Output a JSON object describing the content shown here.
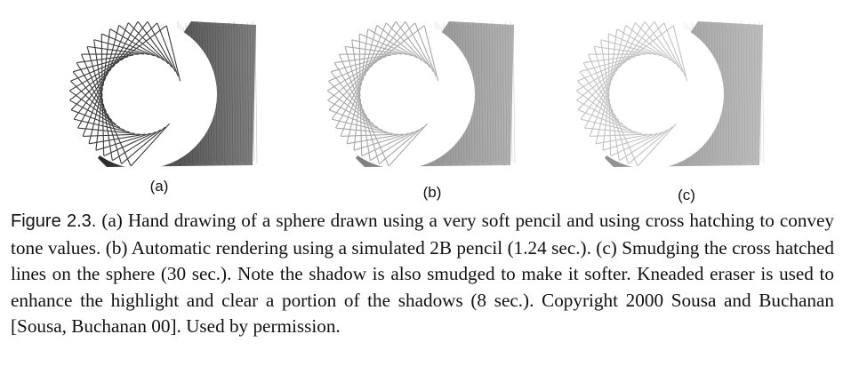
{
  "figure": {
    "sub_labels": [
      "(a)",
      "(b)",
      "(c)"
    ],
    "sketches": [
      {
        "hatch_color": "#3a3a3a",
        "shadow_color": "#1e1e1e",
        "opacity": 1.0
      },
      {
        "hatch_color": "#8a8a8a",
        "shadow_color": "#4a4a4a",
        "opacity": 0.75
      },
      {
        "hatch_color": "#9a9a9a",
        "shadow_color": "#3c3c3c",
        "opacity": 0.6
      }
    ]
  },
  "caption": {
    "figure_label": "Figure 2.3.",
    "text": "(a) Hand drawing of a sphere drawn using a very soft pencil and using cross hatching to convey tone values. (b) Automatic rendering using a simulated 2B pencil (1.24 sec.). (c) Smudging the cross hatched lines on the sphere (30 sec.). Note the shadow is also smudged to make it softer. Kneaded eraser is used to enhance the highlight and clear a portion of the shadows (8 sec.). Copyright 2000 Sousa and Buchanan [Sousa, Buchanan 00]. Used by permission."
  }
}
